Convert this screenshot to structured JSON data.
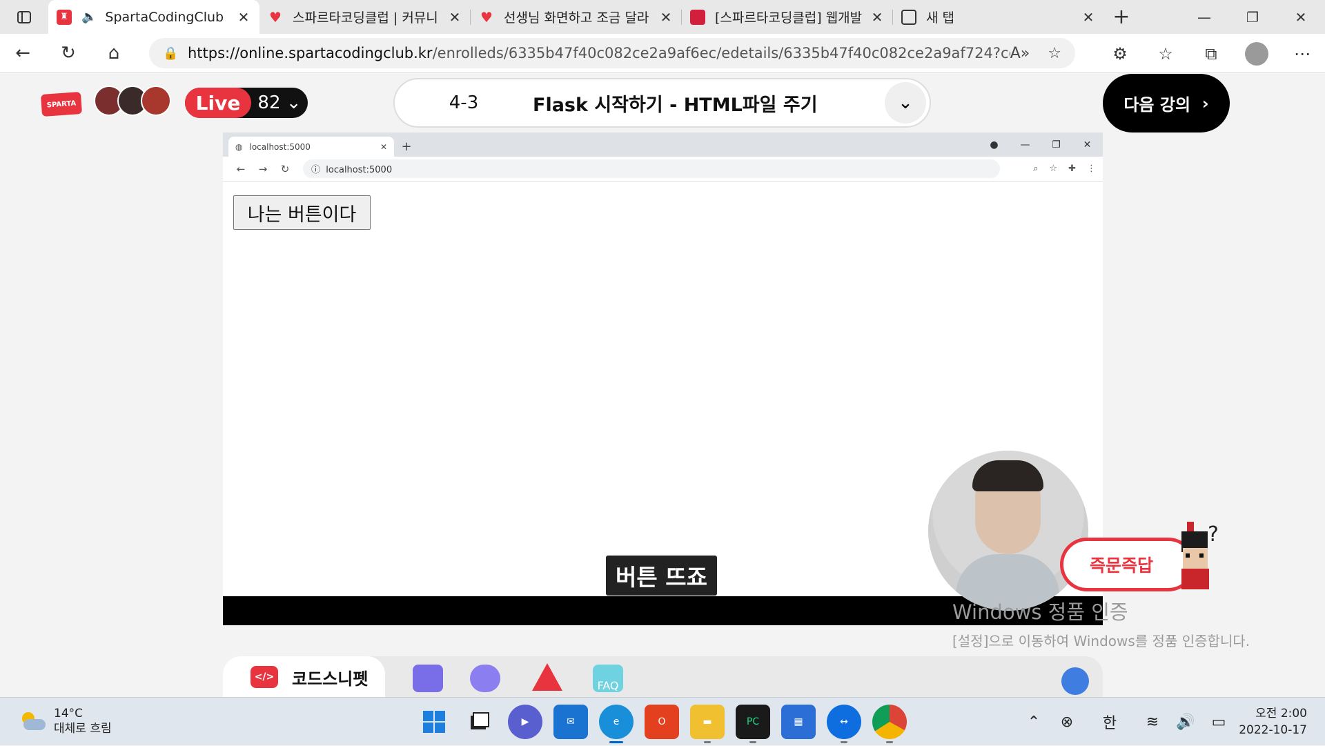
{
  "browser": {
    "tabs": [
      {
        "title": "SpartaCodingClub",
        "active": true
      },
      {
        "title": "스파르타코딩클럽 | 커뮤니",
        "active": false
      },
      {
        "title": "선생님 화면하고 조금 달라",
        "active": false
      },
      {
        "title": "[스파르타코딩클럽] 웹개발",
        "active": false
      },
      {
        "title": "새 탭",
        "active": false
      }
    ],
    "url_host": "https://online.spartacodingclub.kr",
    "url_path": "/enrolleds/6335b47f40c082ce2a9af6ec/edetails/6335b47f40c082ce2a9af724?course_id=6..."
  },
  "header": {
    "logo_text": "SPARTA",
    "live_label": "Live",
    "live_count": "82",
    "lesson_number": "4-3",
    "lesson_title": "Flask 시작하기 - HTML파일 주기",
    "next_button": "다음 강의"
  },
  "video": {
    "inner_tab_title": "localhost:5000",
    "inner_url": "localhost:5000",
    "web_button_label": "나는 버튼이다",
    "caption": "버튼 뜨죠"
  },
  "qa_button": "즉문즉답",
  "watermark": {
    "title": "Windows 정품 인증",
    "body": "[설정]으로 이동하여 Windows를 정품 인증합니다."
  },
  "toolbar": {
    "code_snippet": "코드스니펫",
    "faq": "FAQ"
  },
  "taskbar": {
    "temperature": "14°C",
    "weather": "대체로 흐림",
    "ime": "한",
    "time": "오전 2:00",
    "date": "2022-10-17"
  }
}
